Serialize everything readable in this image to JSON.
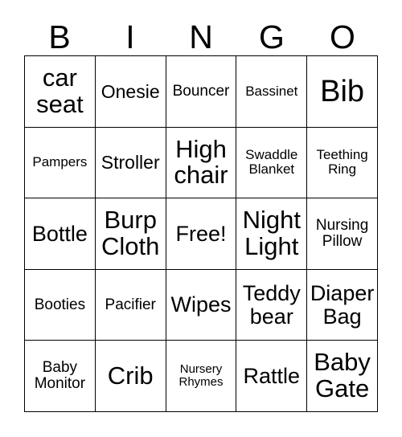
{
  "card": {
    "headers": [
      "B",
      "I",
      "N",
      "G",
      "O"
    ],
    "background_color": "#ffffff",
    "text_color": "#000000",
    "border_color": "#000000",
    "rows": [
      [
        {
          "label": "car\nseat",
          "size": "xl"
        },
        {
          "label": "Onesie",
          "size": "md"
        },
        {
          "label": "Bouncer",
          "size": "sm"
        },
        {
          "label": "Bassinet",
          "size": "xs"
        },
        {
          "label": "Bib",
          "size": "xxl"
        }
      ],
      [
        {
          "label": "Pampers",
          "size": "xs"
        },
        {
          "label": "Stroller",
          "size": "md"
        },
        {
          "label": "High\nchair",
          "size": "xl"
        },
        {
          "label": "Swaddle\nBlanket",
          "size": "xs"
        },
        {
          "label": "Teething\nRing",
          "size": "xs"
        }
      ],
      [
        {
          "label": "Bottle",
          "size": "lg"
        },
        {
          "label": "Burp\nCloth",
          "size": "xl"
        },
        {
          "label": "Free!",
          "size": "lg"
        },
        {
          "label": "Night\nLight",
          "size": "xl"
        },
        {
          "label": "Nursing\nPillow",
          "size": "sm"
        }
      ],
      [
        {
          "label": "Booties",
          "size": "sm"
        },
        {
          "label": "Pacifier",
          "size": "sm"
        },
        {
          "label": "Wipes",
          "size": "lg"
        },
        {
          "label": "Teddy\nbear",
          "size": "lg"
        },
        {
          "label": "Diaper\nBag",
          "size": "lg"
        }
      ],
      [
        {
          "label": "Baby\nMonitor",
          "size": "sm"
        },
        {
          "label": "Crib",
          "size": "xl"
        },
        {
          "label": "Nursery\nRhymes",
          "size": "xxs"
        },
        {
          "label": "Rattle",
          "size": "lg"
        },
        {
          "label": "Baby\nGate",
          "size": "xl"
        }
      ]
    ]
  }
}
